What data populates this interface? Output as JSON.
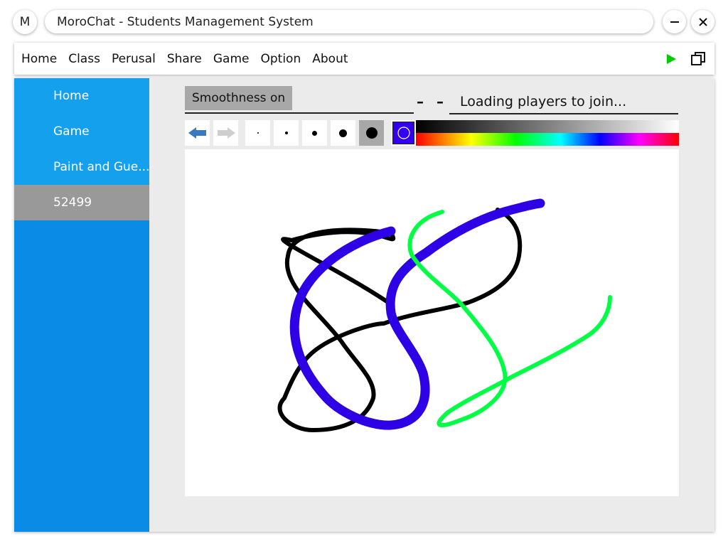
{
  "window": {
    "logo_letter": "M",
    "title": "MoroChat - Students Management System",
    "minimize_icon": "minimize-icon",
    "close_icon": "close-icon"
  },
  "menubar": {
    "items": [
      "Home",
      "Class",
      "Perusal",
      "Share",
      "Game",
      "Option",
      "About"
    ],
    "play_icon": "play-icon",
    "play_color": "#00cc00",
    "restore_icon": "restore-window-icon"
  },
  "sidebar": {
    "items": [
      {
        "label": "Home",
        "active": false
      },
      {
        "label": "Game",
        "active": false
      },
      {
        "label": "Paint and Gue...",
        "active": false
      },
      {
        "label": "52499",
        "active": true
      }
    ],
    "color": "#0a8ce6",
    "item_color": "#14a0ec",
    "active_color": "#999999"
  },
  "game": {
    "smoothness_label": "Smoothness on",
    "dash_a": "–",
    "dash_b": "–",
    "status_text": "Loading players to join..."
  },
  "toolbar": {
    "undo_icon": "undo-arrow-icon",
    "redo_icon": "redo-arrow-icon",
    "brush_sizes": [
      "size-1",
      "size-2",
      "size-3",
      "size-4",
      "size-5"
    ],
    "selected_brush": "size-5",
    "current_color": "#3300ee",
    "palette": "color-palette"
  },
  "drawing": {
    "stroke_colors": [
      "#000000",
      "#2e00e6",
      "#00ff44"
    ]
  }
}
